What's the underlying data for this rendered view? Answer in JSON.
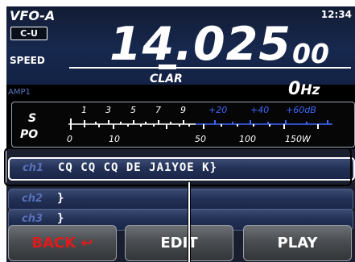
{
  "header": {
    "vfo": "VFO-A",
    "time": "12:34",
    "mode": "C-U",
    "frequency_main": "14.025",
    "frequency_small": "00",
    "speed_label": "SPEED"
  },
  "status": {
    "amp": "AMP1",
    "clar_label": "CLAR",
    "clar_value": "0",
    "clar_unit": "Hz"
  },
  "meter": {
    "s_label": "S",
    "po_label": "PO",
    "s_scale": [
      "1",
      "3",
      "5",
      "7",
      "9",
      "+20",
      "+40",
      "+60dB"
    ],
    "po_scale": [
      "0",
      "10",
      "50",
      "100",
      "150W"
    ],
    "colors": {
      "white": "#ffffff",
      "blue": "#3f67ff"
    }
  },
  "channels": [
    {
      "label": "ch1",
      "text": "CQ CQ CQ DE JA1YOE K}"
    },
    {
      "label": "ch2",
      "text": "}"
    },
    {
      "label": "ch3",
      "text": "}"
    }
  ],
  "buttons": {
    "back": "BACK",
    "edit": "EDIT",
    "play": "PLAY"
  }
}
